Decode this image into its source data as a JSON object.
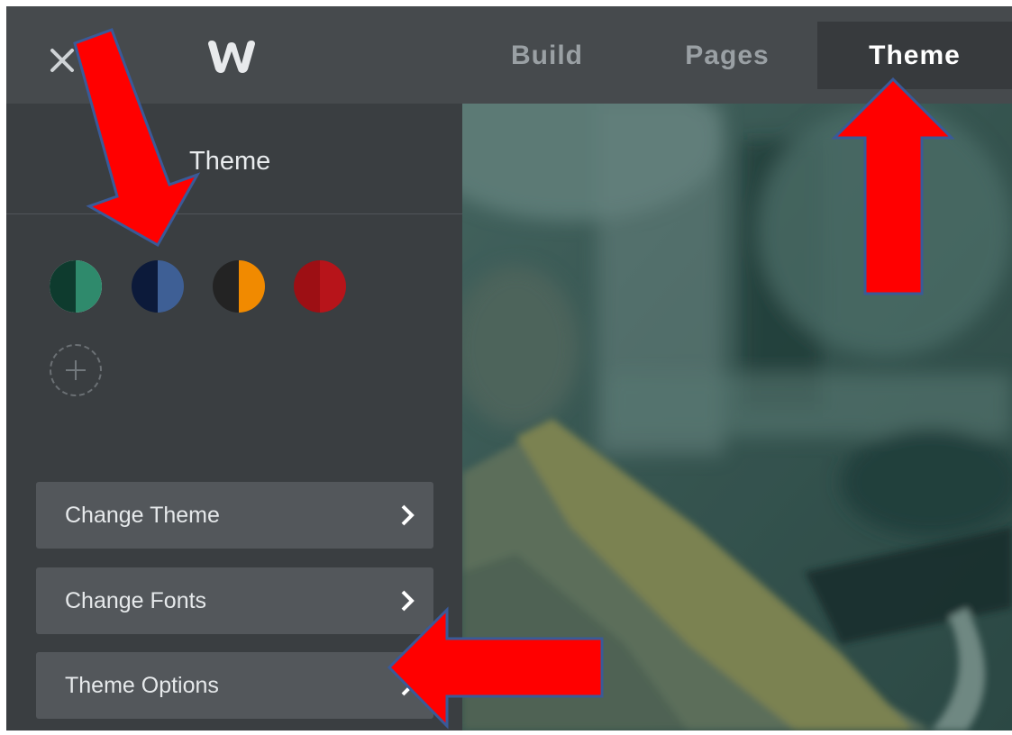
{
  "topbar": {
    "close_icon": "close-icon",
    "logo_icon": "weebly-logo-icon",
    "tabs": [
      {
        "label": "Build"
      },
      {
        "label": "Pages"
      },
      {
        "label": "Theme",
        "active": true
      }
    ]
  },
  "sidebar": {
    "title": "Theme",
    "swatches": [
      {
        "left": "#0e3b2e",
        "right": "#2f8a6c",
        "selected": true
      },
      {
        "left": "#0c1a3a",
        "right": "#3e5f95",
        "selected": false
      },
      {
        "left": "#232323",
        "right": "#f18a00",
        "selected": false
      },
      {
        "left": "#9d0f14",
        "right": "#b7141a",
        "selected": false
      }
    ],
    "add_swatch_icon": "plus-icon",
    "buttons": [
      {
        "label": "Change Theme",
        "icon": "chevron-right-icon"
      },
      {
        "label": "Change Fonts",
        "icon": "chevron-right-icon"
      },
      {
        "label": "Theme Options",
        "icon": "chevron-right-icon"
      }
    ]
  },
  "colors": {
    "annotation_arrow": "#ff0000",
    "annotation_outline": "#3a5a98"
  }
}
